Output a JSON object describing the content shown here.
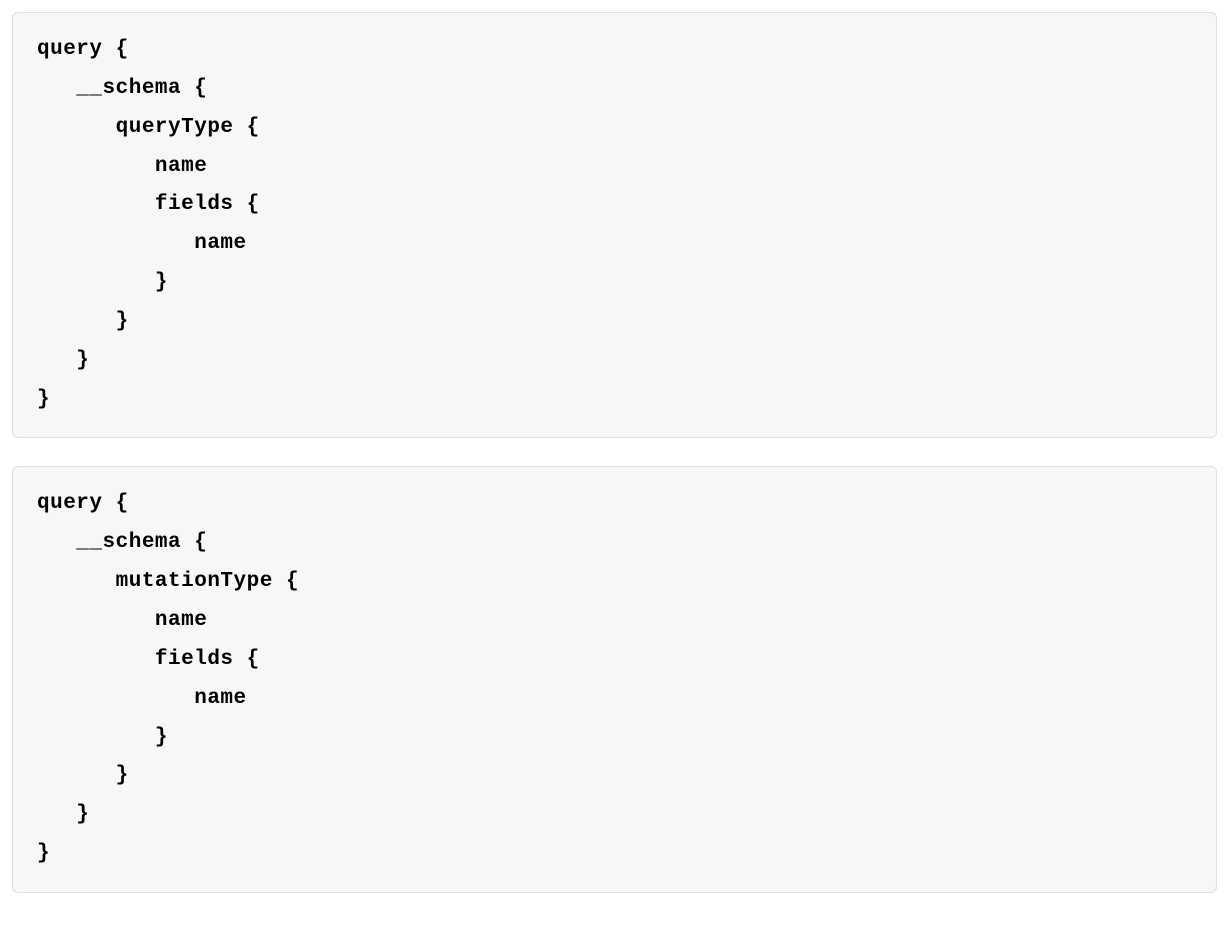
{
  "blocks": {
    "block1": "query {\n   __schema {\n      queryType {\n         name\n         fields {\n            name\n         }\n      }\n   }\n}",
    "block2": "query {\n   __schema {\n      mutationType {\n         name\n         fields {\n            name\n         }\n      }\n   }\n}"
  }
}
